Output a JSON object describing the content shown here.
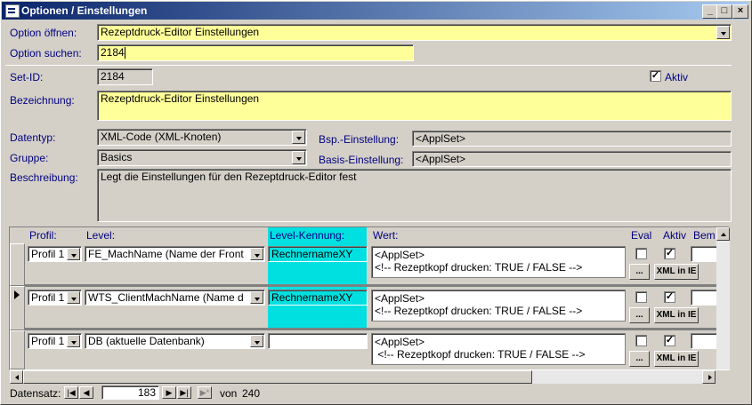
{
  "window": {
    "title": "Optionen / Einstellungen",
    "btn_min": "_",
    "btn_max": "□",
    "btn_close": "×"
  },
  "form": {
    "option_oeffnen_label": "Option öffnen:",
    "option_oeffnen_value": "Rezeptdruck-Editor Einstellungen",
    "option_suchen_label": "Option suchen:",
    "option_suchen_value": "2184",
    "setid_label": "Set-ID:",
    "setid_value": "2184",
    "aktiv_label": "Aktiv",
    "bezeichnung_label": "Bezeichnung:",
    "bezeichnung_value": "Rezeptdruck-Editor Einstellungen",
    "datentyp_label": "Datentyp:",
    "datentyp_value": "XML-Code (XML-Knoten)",
    "gruppe_label": "Gruppe:",
    "gruppe_value": "Basics",
    "bsp_label": "Bsp.-Einstellung:",
    "bsp_value": "<ApplSet>",
    "basis_label": "Basis-Einstellung:",
    "basis_value": "<ApplSet>",
    "beschreibung_label": "Beschreibung:",
    "beschreibung_value": "Legt die Einstellungen für den Rezeptdruck-Editor fest"
  },
  "subform": {
    "headers": {
      "profil": "Profil:",
      "level": "Level:",
      "kennung": "Level-Kennung:",
      "wert": "Wert:",
      "eval": "Eval",
      "aktiv": "Aktiv",
      "bem": "Bem"
    },
    "rows": [
      {
        "profil": "Profil 1",
        "level": "FE_MachName   (Name der Front",
        "kennung": "RechnernameXY",
        "wert1": "<ApplSet>",
        "wert2": "<!-- Rezeptkopf drucken: TRUE / FALSE -->",
        "more": "...",
        "xml": "XML in IE"
      },
      {
        "profil": "Profil 1",
        "level": "WTS_ClientMachName   (Name d",
        "kennung": "RechnernameXY",
        "wert1": "<ApplSet>",
        "wert2": "<!-- Rezeptkopf drucken: TRUE / FALSE -->",
        "more": "...",
        "xml": "XML in IE"
      },
      {
        "profil": "Profil 1",
        "level": "DB   (aktuelle Datenbank)",
        "kennung": "",
        "wert1": "<ApplSet>",
        "wert2": " <!-- Rezeptkopf drucken: TRUE / FALSE -->",
        "more": "...",
        "xml": "XML in IE"
      }
    ]
  },
  "nav": {
    "label": "Datensatz:",
    "current": "183",
    "of_label": "von",
    "total": "240"
  },
  "colors": {
    "titlebar": "#0a246a",
    "yellow": "#ffff99",
    "cyan": "#00e0e0",
    "label": "#000080"
  }
}
